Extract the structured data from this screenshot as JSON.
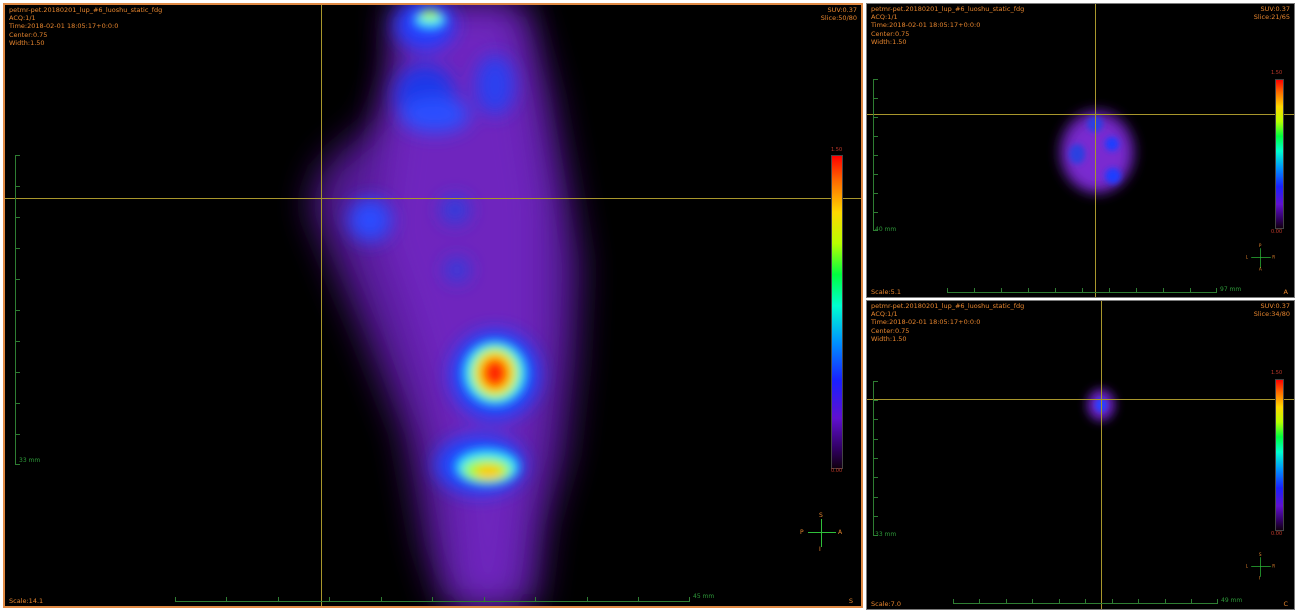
{
  "main_view": {
    "title": "petmr-pet.20180201_lup_#6_luoshu_static_fdg",
    "acq": "ACQ:1/1",
    "time": "Time:2018-02-01 18:05:17+0:0:0",
    "center": "Center:0.75",
    "width": "Width:1.50",
    "suv": "SUV:0.37",
    "slice": "Slice:50/80",
    "scale": "Scale:14.1",
    "vertical_mm": "33 mm",
    "horizontal_mm": "45 mm",
    "cb_max": "1.50",
    "cb_min": "0.00",
    "orient": {
      "top": "S",
      "bottom": "I",
      "left": "P",
      "right": "A"
    },
    "corner": "S"
  },
  "axial_view": {
    "title": "petmr-pet.20180201_lup_#6_luoshu_static_fdg",
    "acq": "ACQ:1/1",
    "time": "Time:2018-02-01 18:05:17+0:0:0",
    "center": "Center:0.75",
    "width": "Width:1.50",
    "suv": "SUV:0.37",
    "slice": "Slice:21/65",
    "scale": "Scale:5.1",
    "vertical_mm": "40 mm",
    "horizontal_mm": "97 mm",
    "cb_max": "1.50",
    "cb_min": "0.00",
    "orient": {
      "top": "P",
      "bottom": "A",
      "left": "L",
      "right": "R"
    },
    "corner": "A"
  },
  "bottom_view": {
    "title": "petmr-pet.20180201_lup_#6_luoshu_static_fdg",
    "acq": "ACQ:1/1",
    "time": "Time:2018-02-01 18:05:17+0:0:0",
    "center": "Center:0.75",
    "width": "Width:1.50",
    "suv": "SUV:0.37",
    "slice": "Slice:34/80",
    "scale": "Scale:7.0",
    "vertical_mm": "33 mm",
    "horizontal_mm": "49 mm",
    "cb_max": "1.50",
    "cb_min": "0.00",
    "orient": {
      "top": "S",
      "bottom": "I",
      "left": "L",
      "right": "R"
    },
    "corner": "C"
  }
}
